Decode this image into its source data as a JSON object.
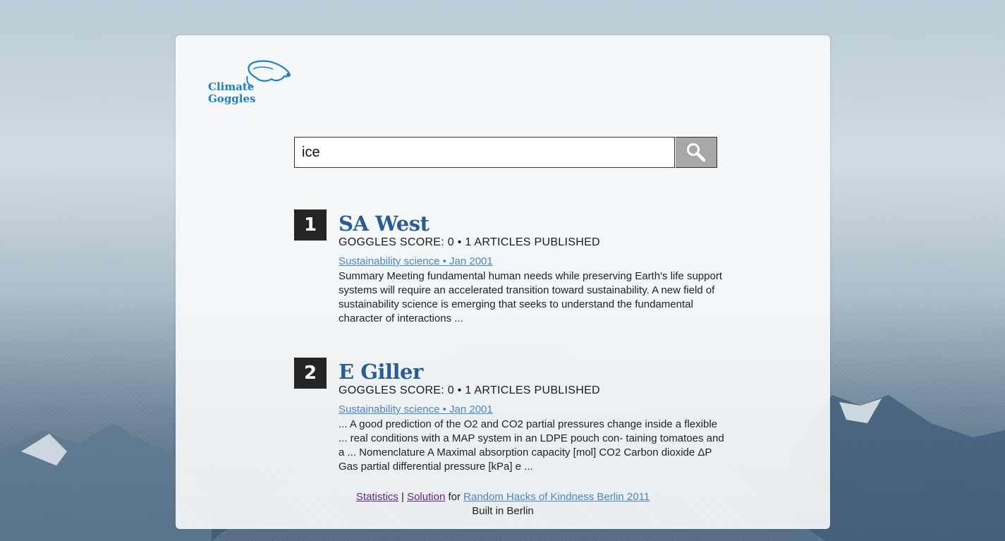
{
  "logo": {
    "line1": "Climate",
    "line2": "Goggles",
    "icon": "goggles-icon",
    "color": "#1f7fc3"
  },
  "search": {
    "value": "ice",
    "placeholder": "",
    "button_icon": "search-icon"
  },
  "results": [
    {
      "rank": "1",
      "title": "SA West",
      "meta": "GOGGLES SCORE: 0 • 1 ARTICLES PUBLISHED",
      "source": "Sustainability science • Jan 2001",
      "snippet": "Summary Meeting fundamental human needs while preserving Earth's life support systems will require an accelerated transition toward sustainability. A new field of sustainability science is emerging that seeks to understand the fundamental character of interactions ..."
    },
    {
      "rank": "2",
      "title": "E Giller",
      "meta": "GOGGLES SCORE: 0 • 1 ARTICLES PUBLISHED",
      "source": "Sustainability science • Jan 2001",
      "snippet": "... A good prediction of the O2 and CO2 partial pressures change inside a flexible ... real conditions with a MAP system in an LDPE pouch con- taining tomatoes and a ... Nomenclature A Maximal absorption capacity [mol] CO2 Carbon dioxide ΔP Gas partial differential pressure [kPa] e ..."
    }
  ],
  "footer": {
    "statistics": "Statistics",
    "separator": "|",
    "solution": "Solution",
    "for_text": "for",
    "event_link": "Random Hacks of Kindness Berlin 2011",
    "built": "Built in Berlin"
  },
  "colors": {
    "title": "#2a5d94",
    "link": "#4a86c5",
    "visited": "#5a2a86",
    "rank_bg": "#252525"
  }
}
